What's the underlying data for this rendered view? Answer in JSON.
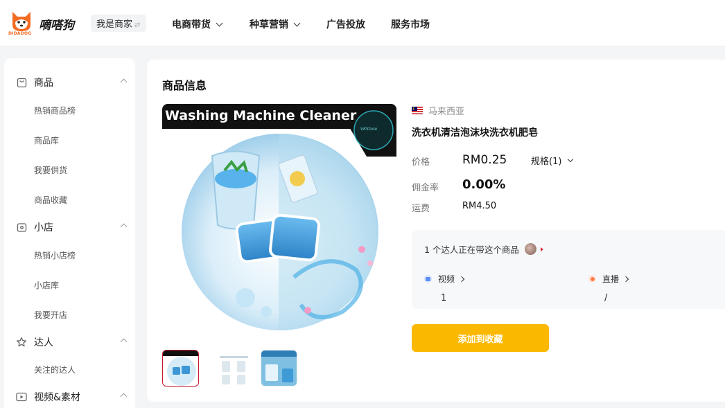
{
  "header": {
    "logo_caption": "DIDADOG",
    "logo_text": "嘀嗒狗",
    "merchant_switch": "我是商家",
    "nav": [
      {
        "label": "电商带货",
        "has_dropdown": true
      },
      {
        "label": "种草营销",
        "has_dropdown": true
      },
      {
        "label": "广告投放",
        "has_dropdown": false
      },
      {
        "label": "服务市场",
        "has_dropdown": false
      }
    ]
  },
  "sidebar": {
    "sections": [
      {
        "label": "商品",
        "icon": "bag-icon",
        "items": [
          "热销商品榜",
          "商品库",
          "我要供货",
          "商品收藏"
        ]
      },
      {
        "label": "小店",
        "icon": "store-icon",
        "items": [
          "热销小店榜",
          "小店库",
          "我要开店"
        ]
      },
      {
        "label": "达人",
        "icon": "star-icon",
        "items": [
          "关注的达人"
        ]
      },
      {
        "label": "视频&素材",
        "icon": "video-icon",
        "items": []
      }
    ]
  },
  "main": {
    "title": "商品信息",
    "image_banner": "Washing Machine Cleaner",
    "image_badge": "VKStore",
    "country": "马来西亚",
    "product_name": "洗衣机清洁泡沫块洗衣机肥皂",
    "price_label": "价格",
    "price_value": "RM0.25",
    "spec_label": "规格(1)",
    "commission_label": "佣金率",
    "commission_value": "0.00%",
    "shipping_label": "运费",
    "shipping_value": "RM4.50",
    "kol": {
      "line": "1 个达人正在带这个商品",
      "video_label": "视频",
      "video_value": "1",
      "live_label": "直播",
      "live_value": "/"
    },
    "favorite_button": "添加到收藏"
  },
  "colors": {
    "accent": "#fbb800",
    "logo_orange": "#f26b21",
    "active_thumb_border": "#c8192f",
    "video_dot": "#5b8ff9",
    "live_dot": "#ff7a45"
  }
}
